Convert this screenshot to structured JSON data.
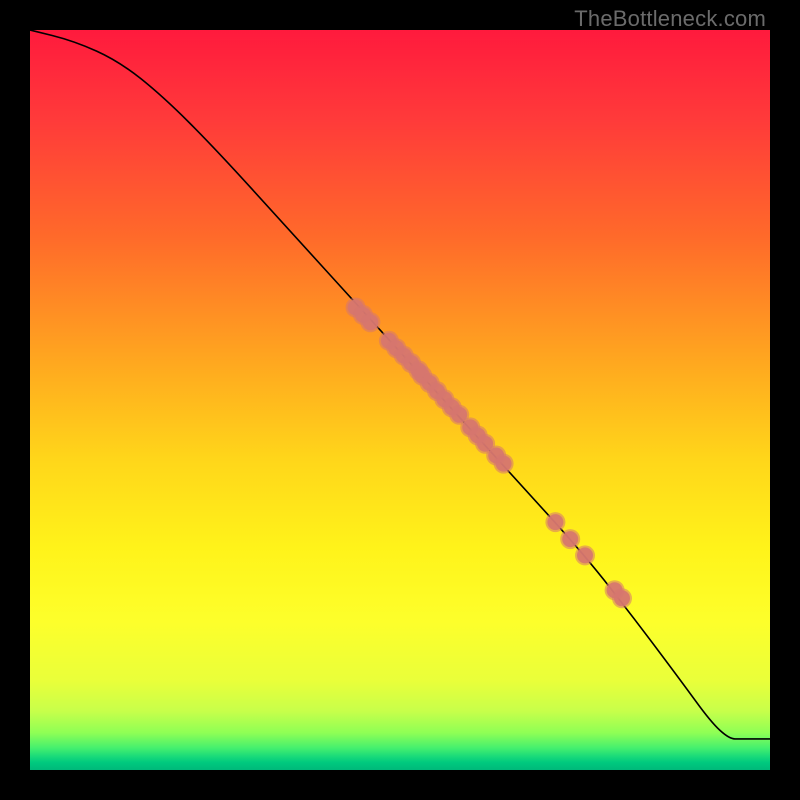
{
  "watermark": "TheBottleneck.com",
  "colors": {
    "frame": "#000000",
    "curve": "#000000",
    "dot": "#d6766f"
  },
  "chart_data": {
    "type": "line",
    "title": "",
    "xlabel": "",
    "ylabel": "",
    "xlim": [
      0,
      100
    ],
    "ylim": [
      0,
      100
    ],
    "grid": false,
    "legend": false,
    "gradient_stops": [
      {
        "pos": 0,
        "color": "#ff1a3d"
      },
      {
        "pos": 28,
        "color": "#ff6a2a"
      },
      {
        "pos": 58,
        "color": "#ffd61a"
      },
      {
        "pos": 80,
        "color": "#fdff2b"
      },
      {
        "pos": 95,
        "color": "#8eff55"
      },
      {
        "pos": 100,
        "color": "#00b97a"
      }
    ],
    "series": [
      {
        "name": "curve",
        "kind": "line",
        "points_xy": [
          [
            0,
            100
          ],
          [
            6,
            98.5
          ],
          [
            12,
            95.8
          ],
          [
            18,
            91
          ],
          [
            25,
            84
          ],
          [
            35,
            73
          ],
          [
            45,
            62
          ],
          [
            55,
            51
          ],
          [
            65,
            40
          ],
          [
            75,
            29
          ],
          [
            82,
            20
          ],
          [
            88,
            12
          ],
          [
            92,
            6.5
          ],
          [
            94.5,
            4.2
          ],
          [
            96,
            4.2
          ],
          [
            100,
            4.2
          ]
        ]
      },
      {
        "name": "markers",
        "kind": "scatter",
        "points_xy": [
          [
            44,
            62.5
          ],
          [
            45,
            61.5
          ],
          [
            46,
            60.5
          ],
          [
            48.5,
            58
          ],
          [
            49.5,
            57
          ],
          [
            50.5,
            56
          ],
          [
            51.5,
            55
          ],
          [
            52.5,
            54
          ],
          [
            53,
            53.3
          ],
          [
            54,
            52.3
          ],
          [
            55,
            51.2
          ],
          [
            56,
            50.1
          ],
          [
            57,
            49
          ],
          [
            58,
            48
          ],
          [
            59.5,
            46.3
          ],
          [
            60.5,
            45.2
          ],
          [
            61.5,
            44.1
          ],
          [
            63,
            42.5
          ],
          [
            64,
            41.4
          ],
          [
            71,
            33.5
          ],
          [
            73,
            31.2
          ],
          [
            75,
            29
          ],
          [
            79,
            24.3
          ],
          [
            80,
            23.2
          ]
        ],
        "marker_radius_px": 8
      }
    ]
  }
}
